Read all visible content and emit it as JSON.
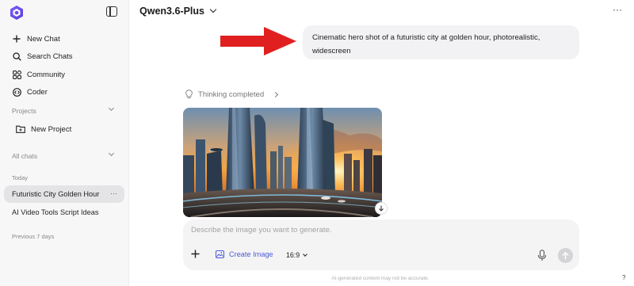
{
  "sidebar": {
    "nav": [
      {
        "label": "New Chat",
        "icon": "plus-icon"
      },
      {
        "label": "Search Chats",
        "icon": "search-icon"
      },
      {
        "label": "Community",
        "icon": "grid-icon"
      },
      {
        "label": "Coder",
        "icon": "code-icon"
      }
    ],
    "projects_label": "Projects",
    "new_project_label": "New Project",
    "all_chats_label": "All chats",
    "today_label": "Today",
    "chats_today": [
      {
        "title": "Futuristic City Golden Hour",
        "active": true
      },
      {
        "title": "AI Video Tools Script Ideas",
        "active": false
      }
    ],
    "previous_label": "Previous 7 days"
  },
  "header": {
    "model_name": "Qwen3.6-Plus",
    "more_label": "···"
  },
  "conversation": {
    "user_message": "Cinematic hero shot of a futuristic city at golden hour, photorealistic, widescreen",
    "thinking_label": "Thinking completed",
    "image_icon": "download-icon"
  },
  "composer": {
    "placeholder": "Describe the image you want to generate.",
    "create_image_label": "Create Image",
    "ratio_label": "16:9"
  },
  "footer": {
    "disclaimer": "AI-generated content may not be accurate.",
    "help_label": "?"
  },
  "colors": {
    "accent": "#4a5bd8",
    "annotation_arrow": "#e02020",
    "active_chat_bg": "#e4e4e7"
  }
}
